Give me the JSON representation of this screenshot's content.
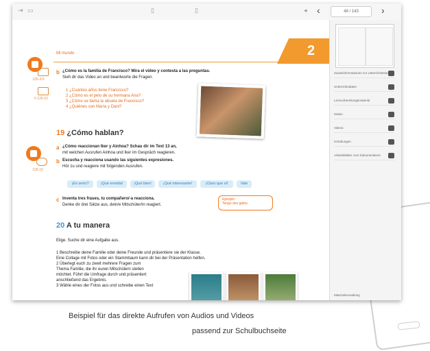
{
  "toolbar": {
    "page_indicator": "48 / 143"
  },
  "page": {
    "section_header": "Mi mundo",
    "chapter_number": "2",
    "part_b": {
      "label": "b",
      "instruction_es": "¿Cómo es la familia de Francisco? Mira el vídeo y contesta a las preguntas.",
      "instruction_de": "Sieh dir das Video an und beantworte die Fragen.",
      "questions": [
        "1 ¿Cuántos años tiene Francisco?",
        "2 ¿Cómo es el pelo de su hermana Ana?",
        "3 ¿Cómo se llama la abuela de Francisco?",
        "4 ¿Quiénes son María y Dani?"
      ]
    },
    "ex19": {
      "number": "19",
      "title": "¿Cómo hablan?",
      "a_label": "a",
      "a_line1": "¿Cómo reaccionan Iker y Ainhoa? Schau dir im Text 13 an,",
      "a_line2": "mit welchen Ausrufen Ainhoa und Iker im Gespräch reagieren.",
      "b_label": "b",
      "b_line1": "Escucha y reacciona usando las siguientes expresiones.",
      "b_line2": "Hör zu und reagiere mit folgenden Ausrufen.",
      "chips": [
        "¡En serio?",
        "¡Qué envidia!",
        "¡Qué bien!",
        "¡Qué interesante!",
        "¡Claro que sí!",
        "Vale"
      ],
      "c_label": "c",
      "c_line1": "Inventa tres frases, tu compañero/-a reacciona.",
      "c_line2": "Denke dir drei Sätze aus, dein/e Mitschüler/in reagiert.",
      "speech_line1": "Ejemplo:",
      "speech_line2": "Tengo dos gatos."
    },
    "ex20": {
      "number": "20",
      "title": "A tu manera",
      "elige": "Elige. Suche dir eine Aufgabe aus.",
      "items": [
        "1 Beschreibe deine Familie oder deine Freunde und präsentiere sie der Klasse.",
        "   Eine Collage mit Fotos oder ein Stammbaum kann dir bei der Präsentation helfen.",
        "2 Überlegt euch zu zweit mehrere Fragen zum",
        "   Thema Familie, die ihr euren Mitschülern stellen",
        "   möchtet. Führt die Umfrage durch und präsentiert",
        "   anschließend das Ergebnis.",
        "3 Wähle eines der Fotos aus und schreibe einen Text"
      ]
    },
    "left_media": {
      "video_code": "126-3-5",
      "audio_code": "h 126-10",
      "audio2_code": "126-10"
    }
  },
  "sidebar": {
    "items": [
      "Zusatzinformationen zur Unterrichtsstunde",
      "Unterrichtsdaten",
      "Lernvorbereitungsmaterial",
      "Seiten",
      "Videos",
      "Hörübungen",
      "Arbeitsblätter zum Dokumentieren"
    ],
    "footer": "Materialverwaltung"
  },
  "captions": {
    "line1": "Beispiel für das direkte Aufrufen von Audios und Videos",
    "line2": "passend zur Schulbuchseite"
  },
  "colors": {
    "accent_orange": "#f07a1f",
    "accent_blue": "#3a9ad9"
  }
}
